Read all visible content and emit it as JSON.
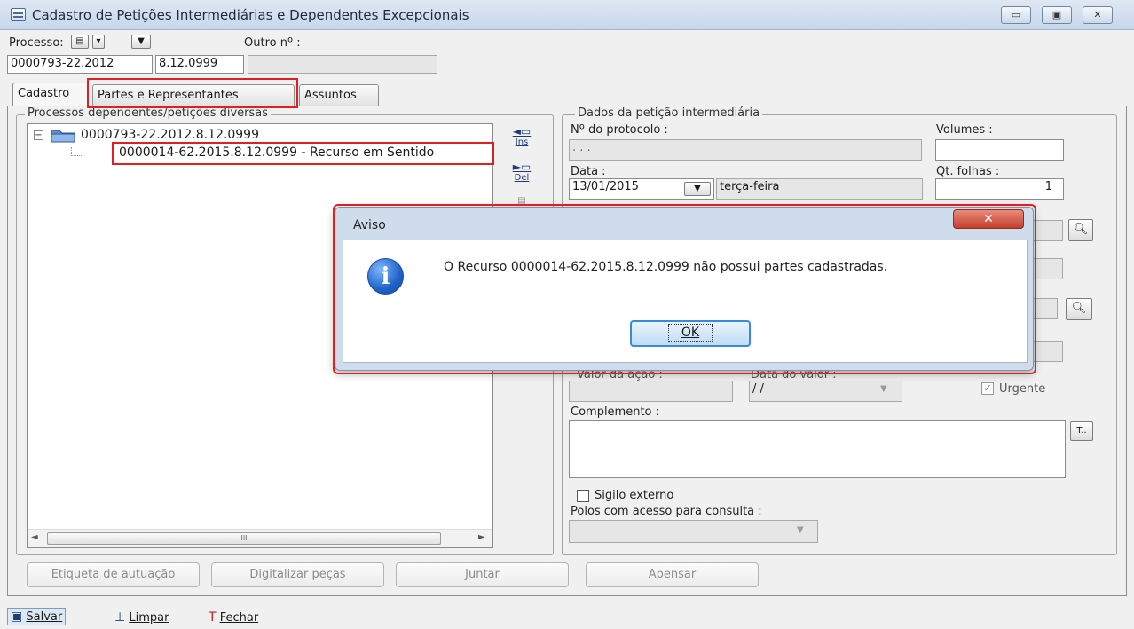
{
  "window": {
    "title": "Cadastro de Petições Intermediárias e Dependentes Excepcionais",
    "controls": {
      "minimize": "▭",
      "maximize": "▣",
      "close": "✕"
    }
  },
  "processo": {
    "label": "Processo:",
    "outro_label": "Outro nº :",
    "numero": "0000793-22.2012",
    "segmento": "8.12.0999",
    "outro_value": ""
  },
  "tabs": [
    "Cadastro",
    "Partes e Representantes",
    "Assuntos"
  ],
  "left_group": {
    "legend": "Processos dependentes/petições diversas",
    "tree": {
      "root": "0000793-22.2012.8.12.0999",
      "child": "0000014-62.2015.8.12.0999 - Recurso em Sentido"
    },
    "scroll_thumb": "III"
  },
  "tools": {
    "ins": "Ins",
    "del": "Del"
  },
  "right_group": {
    "legend": "Dados da petição intermediária",
    "protocolo_label": "Nº do protocolo :",
    "protocolo_value": ". .   .",
    "volumes_label": "Volumes :",
    "volumes_value": "",
    "data_label": "Data :",
    "data_value": "13/01/2015",
    "weekday": "terça-feira",
    "folhas_label": "Qt. folhas :",
    "folhas_value": "1",
    "valor_acao_label": "Valor da ação :",
    "valor_acao_value": "",
    "data_valor_label": "Data do valor :",
    "data_valor_value": "/ /",
    "urgente_label": "Urgente",
    "complemento_label": "Complemento :",
    "complemento_value": "",
    "sigilo_label": "Sigilo externo",
    "polos_label": "Polos com acesso para consulta :",
    "polos_value": ""
  },
  "actions": [
    "Etiqueta de autuação",
    "Digitalizar peças",
    "Juntar",
    "Apensar"
  ],
  "toolbar": {
    "salvar": "Salvar",
    "limpar": "Limpar",
    "fechar": "Fechar"
  },
  "dialog": {
    "title": "Aviso",
    "message": "O Recurso 0000014-62.2015.8.12.0999 não possui partes cadastradas.",
    "ok": "OK",
    "close": "✕",
    "icon": "info-icon"
  },
  "colors": {
    "highlight_red": "#e02020",
    "ok_border": "#3b8ad8",
    "info_blue": "#1f62c8"
  }
}
